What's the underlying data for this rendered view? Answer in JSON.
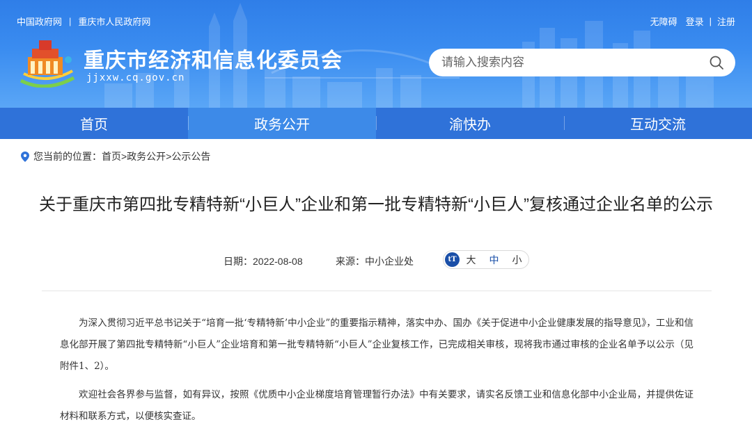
{
  "header": {
    "top_links_left": [
      "中国政府网",
      "重庆市人民政府网"
    ],
    "top_links_left_sep": "|",
    "top_links_right": {
      "accessibility": "无障碍",
      "login": "登录",
      "sep": "|",
      "register": "注册"
    },
    "site_title": "重庆市经济和信息化委员会",
    "site_domain": "jjxxw.cq.gov.cn",
    "search_placeholder": "请输入搜索内容"
  },
  "nav": {
    "items": [
      {
        "label": "首页"
      },
      {
        "label": "政务公开"
      },
      {
        "label": "渝快办"
      },
      {
        "label": "互动交流"
      }
    ],
    "active_index": 1
  },
  "breadcrumb": {
    "prefix": "您当前的位置：",
    "items": [
      "首页",
      ">政务公开",
      ">公示公告"
    ]
  },
  "article": {
    "title": "关于重庆市第四批专精特新“小巨人”企业和第一批专精特新“小巨人”复核通过企业名单的公示",
    "date_label": "日期：2022-08-08",
    "source_label": "来源：中小企业处",
    "font_size": {
      "large": "大",
      "medium": "中",
      "small": "小"
    },
    "paragraphs": [
      "为深入贯彻习近平总书记关于“培育一批‘专精特新’中小企业”的重要指示精神，落实中办、国办《关于促进中小企业健康发展的指导意见》，工业和信息化部开展了第四批专精特新“小巨人”企业培育和第一批专精特新“小巨人”企业复核工作，已完成相关审核，现将我市通过审核的企业名单予以公示（见附件1、2）。",
      "欢迎社会各界参与监督，如有异议，按照《优质中小企业梯度培育管理暂行办法》中有关要求，请实名反馈工业和信息化部中小企业局，并提供佐证材料和联系方式，以便核实查证。"
    ]
  },
  "colors": {
    "header_blue": "#3a8cf0",
    "nav_blue": "#2f72d9",
    "nav_active": "#3d8ae8",
    "accent_dark": "#1a4fa8"
  },
  "icons": {
    "search": "search-icon",
    "location": "location-pin-icon",
    "font_size": "text-size-icon"
  }
}
